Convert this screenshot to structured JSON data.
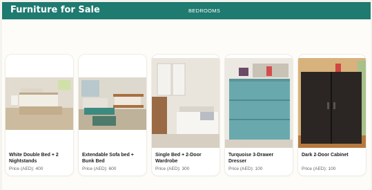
{
  "header": {
    "brand": "Furniture for Sale",
    "nav_label": "BEDROOMS"
  },
  "listings": [
    {
      "title": "White Double Bed + 2 Nightstands",
      "price": "Price (AED): 400"
    },
    {
      "title": "Extendable Sofa bed + Bunk Bed",
      "price": "Price (AED): 600"
    },
    {
      "title": "Single Bed + 2-Door Wardrobe",
      "price": "Price (AED): 300"
    },
    {
      "title": "Turquoise 3-Drawer Dresser",
      "price": "Price (AED): 100"
    },
    {
      "title": "Dark 2-Door Cabinet",
      "price": "Price (AED): 100"
    }
  ],
  "colors": {
    "header_bg": "#1f7a70",
    "page_bg": "#fdfcf8"
  }
}
